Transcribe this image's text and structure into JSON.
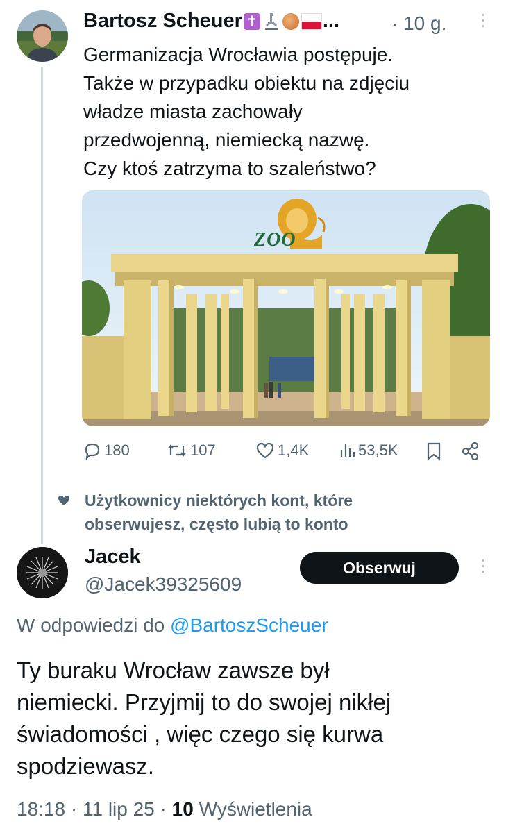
{
  "tweet": {
    "author_name": "Bartosz Scheuer",
    "name_ellipsis": "...",
    "separator": "·",
    "time": "10 g.",
    "more": "⋮",
    "text_lines": [
      "Germanizacja Wrocławia postępuje.",
      "Także w przypadku obiektu na zdjęciu",
      "władze miasta zachowały",
      "przedwojenną, niemiecką nazwę.",
      "Czy ktoś zatrzyma to szaleństwo?"
    ],
    "image": {
      "sign_text": "ZOO"
    },
    "stats": {
      "replies": "180",
      "reposts": "107",
      "likes": "1,4K",
      "views": "53,5K"
    }
  },
  "recommendation": {
    "lines": [
      "Użytkownicy niektórych kont, które",
      "obserwujesz, często lubią to konto"
    ]
  },
  "reply": {
    "author_name": "Jacek",
    "handle": "@Jacek39325609",
    "follow_label": "Obserwuj",
    "more": "⋮",
    "reply_to_prefix": "W odpowiedzi do",
    "reply_to_mention": "@BartoszScheuer",
    "text_lines": [
      "Ty buraku Wrocław zawsze był",
      "niemiecki. Przyjmij to do swojej nikłej",
      "świadomości , więc czego się kurwa",
      "spodziewasz."
    ],
    "time": "18:18",
    "date": "11 lip 25",
    "separator": "·",
    "views_count": "10",
    "views_label": "Wyświetlenia"
  },
  "colors": {
    "text": "#0f1419",
    "secondary": "#536471",
    "link": "#1d9bf0",
    "thread_line": "#cfd9de",
    "button_bg": "#0f1419"
  }
}
